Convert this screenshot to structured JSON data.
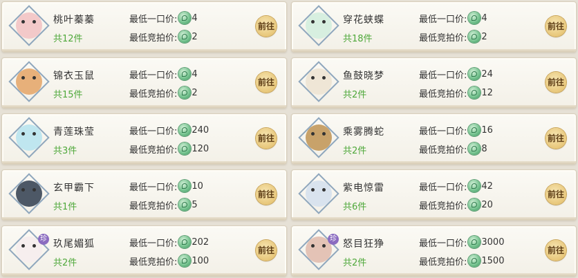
{
  "labels": {
    "buyout_label": "最低一口价:",
    "auction_label": "最低竞拍价:",
    "go_button": "前往"
  },
  "items": [
    {
      "name": "桃叶蓁蓁",
      "count": "共12件",
      "buyout": "4",
      "auction": "2",
      "avatar_color": "#f3c9c9",
      "rare": ""
    },
    {
      "name": "穿花蛱蝶",
      "count": "共18件",
      "buyout": "4",
      "auction": "2",
      "avatar_color": "#d7efe0",
      "rare": ""
    },
    {
      "name": "锦衣玉鼠",
      "count": "共15件",
      "buyout": "4",
      "auction": "2",
      "avatar_color": "#e7b07a",
      "rare": ""
    },
    {
      "name": "鱼鼓晓梦",
      "count": "共2件",
      "buyout": "24",
      "auction": "12",
      "avatar_color": "#efe6d6",
      "rare": ""
    },
    {
      "name": "青莲珠莹",
      "count": "共3件",
      "buyout": "240",
      "auction": "120",
      "avatar_color": "#bfe6ef",
      "rare": ""
    },
    {
      "name": "乘雾腾蛇",
      "count": "共2件",
      "buyout": "16",
      "auction": "8",
      "avatar_color": "#c8a26a",
      "rare": ""
    },
    {
      "name": "玄甲霸下",
      "count": "共1件",
      "buyout": "10",
      "auction": "5",
      "avatar_color": "#4d5866",
      "rare": ""
    },
    {
      "name": "紫电惊雷",
      "count": "共6件",
      "buyout": "42",
      "auction": "20",
      "avatar_color": "#d9e3ee",
      "rare": ""
    },
    {
      "name": "玖尾媚狐",
      "count": "共2件",
      "buyout": "202",
      "auction": "100",
      "avatar_color": "#f6eeee",
      "rare": "珍"
    },
    {
      "name": "怒目狂狰",
      "count": "共2件",
      "buyout": "3000",
      "auction": "1500",
      "avatar_color": "#e4c3b6",
      "rare": "珍"
    }
  ]
}
